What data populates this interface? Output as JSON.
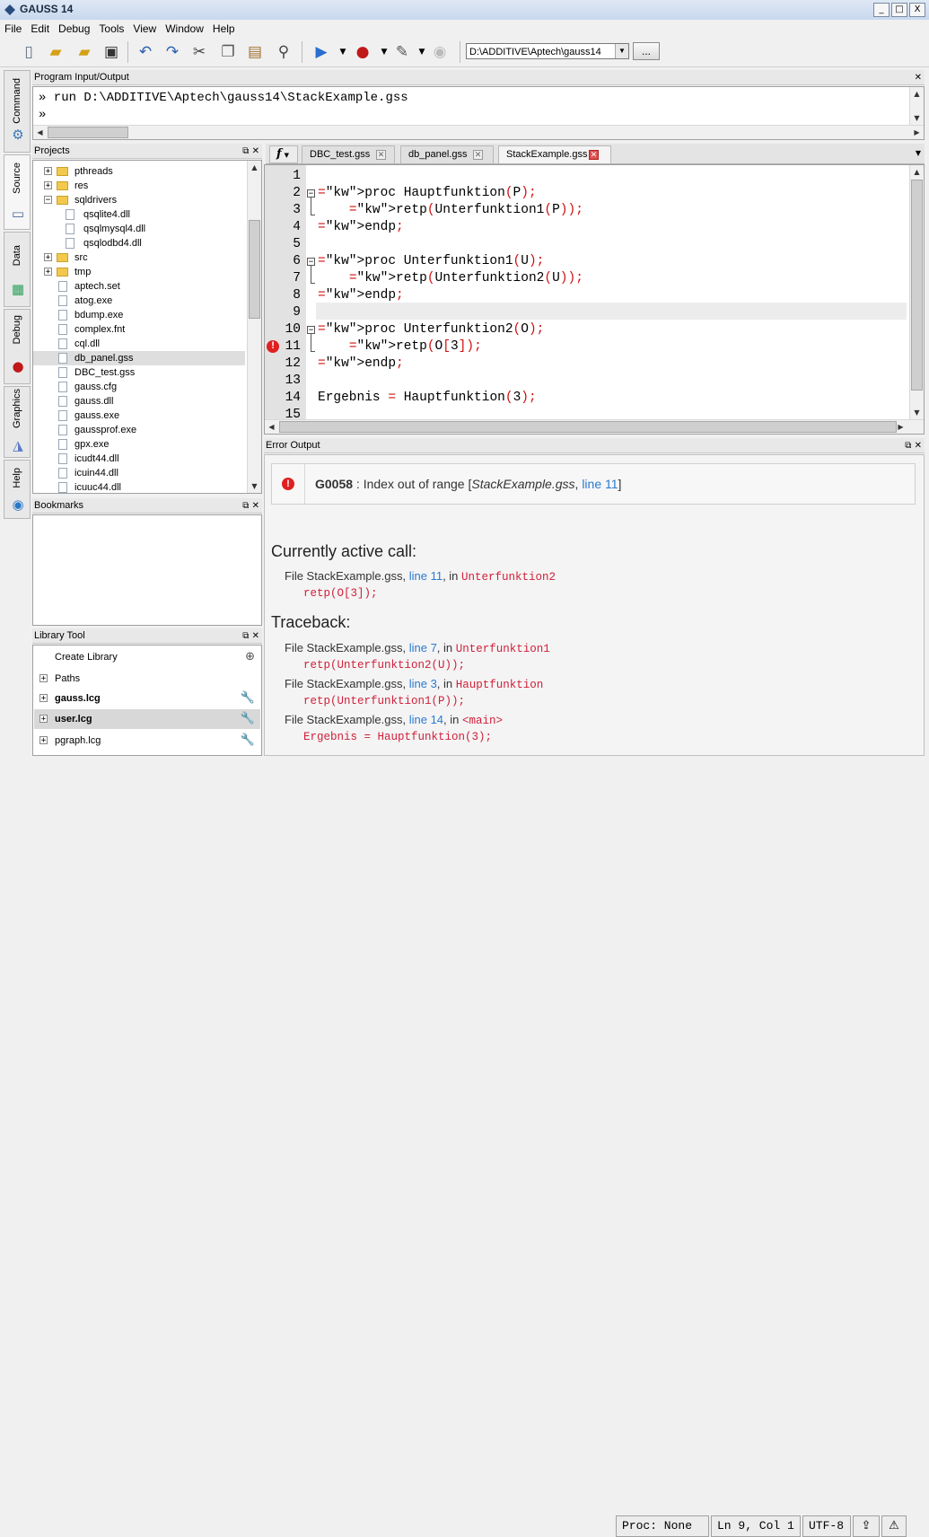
{
  "window": {
    "title": "GAUSS 14",
    "minimize": "_",
    "maximize": "□",
    "close": "X"
  },
  "menu": [
    "File",
    "Edit",
    "Debug",
    "Tools",
    "View",
    "Window",
    "Help"
  ],
  "toolbar": {
    "working_dir": "D:\\ADDITIVE\\Aptech\\gauss14",
    "browse_label": "..."
  },
  "side_tabs": [
    "Command",
    "Source",
    "Data",
    "Debug",
    "Graphics",
    "Help"
  ],
  "program_io": {
    "title": "Program Input/Output",
    "lines": [
      "» run D:\\ADDITIVE\\Aptech\\gauss14\\StackExample.gss",
      "»"
    ]
  },
  "projects": {
    "title": "Projects",
    "items": [
      {
        "name": "pthreads",
        "type": "folder",
        "expander": "+"
      },
      {
        "name": "res",
        "type": "folder",
        "expander": "+"
      },
      {
        "name": "sqldrivers",
        "type": "folder",
        "expander": "−"
      },
      {
        "name": "qsqlite4.dll",
        "type": "file",
        "indent": 1
      },
      {
        "name": "qsqlmysql4.dll",
        "type": "file",
        "indent": 1
      },
      {
        "name": "qsqlodbd4.dll",
        "type": "file",
        "indent": 1
      },
      {
        "name": "src",
        "type": "folder",
        "expander": "+"
      },
      {
        "name": "tmp",
        "type": "folder",
        "expander": "+"
      },
      {
        "name": "aptech.set",
        "type": "file"
      },
      {
        "name": "atog.exe",
        "type": "file"
      },
      {
        "name": "bdump.exe",
        "type": "file"
      },
      {
        "name": "complex.fnt",
        "type": "file"
      },
      {
        "name": "cql.dll",
        "type": "file"
      },
      {
        "name": "db_panel.gss",
        "type": "file",
        "selected": true
      },
      {
        "name": "DBC_test.gss",
        "type": "file"
      },
      {
        "name": "gauss.cfg",
        "type": "file"
      },
      {
        "name": "gauss.dll",
        "type": "file"
      },
      {
        "name": "gauss.exe",
        "type": "file"
      },
      {
        "name": "gaussprof.exe",
        "type": "file"
      },
      {
        "name": "gpx.exe",
        "type": "file"
      },
      {
        "name": "icudt44.dll",
        "type": "file"
      },
      {
        "name": "icuin44.dll",
        "type": "file"
      },
      {
        "name": "icuuc44.dll",
        "type": "file"
      }
    ]
  },
  "bookmarks": {
    "title": "Bookmarks"
  },
  "library_tool": {
    "title": "Library Tool",
    "create_label": "Create Library",
    "items": [
      {
        "name": "Paths",
        "bold": false
      },
      {
        "name": "gauss.lcg",
        "bold": true
      },
      {
        "name": "user.lcg",
        "bold": true,
        "selected": true
      },
      {
        "name": "pgraph.lcg",
        "bold": false
      }
    ]
  },
  "editor": {
    "func_button": "f",
    "tabs": [
      {
        "label": "DBC_test.gss",
        "active": false
      },
      {
        "label": "db_panel.gss",
        "active": false
      },
      {
        "label": "StackExample.gss",
        "active": true
      }
    ],
    "lines": [
      {
        "n": "1",
        "code": ""
      },
      {
        "n": "2",
        "code": "proc Hauptfunktion(P);"
      },
      {
        "n": "3",
        "code": "    retp(Unterfunktion1(P));"
      },
      {
        "n": "4",
        "code": "endp;"
      },
      {
        "n": "5",
        "code": ""
      },
      {
        "n": "6",
        "code": "proc Unterfunktion1(U);"
      },
      {
        "n": "7",
        "code": "    retp(Unterfunktion2(U));"
      },
      {
        "n": "8",
        "code": "endp;"
      },
      {
        "n": "9",
        "code": ""
      },
      {
        "n": "10",
        "code": "proc Unterfunktion2(O);"
      },
      {
        "n": "11",
        "code": "    retp(O[3]);"
      },
      {
        "n": "12",
        "code": "endp;"
      },
      {
        "n": "13",
        "code": ""
      },
      {
        "n": "14",
        "code": "Ergebnis = Hauptfunktion(3);"
      },
      {
        "n": "15",
        "code": ""
      }
    ]
  },
  "error_output": {
    "title": "Error Output",
    "code": "G0058",
    "message": " : Index out of range [",
    "file": "StackExample.gss",
    "sep": ", ",
    "line_link": "line 11",
    "close": "]",
    "active_call_heading": "Currently active call:",
    "active_call": {
      "prefix": "File StackExample.gss, ",
      "link": "line 11",
      "mid": ", in ",
      "func": "Unterfunktion2",
      "code": "retp(O[3]);"
    },
    "traceback_heading": "Traceback:",
    "traceback": [
      {
        "prefix": "File StackExample.gss, ",
        "link": "line 7",
        "mid": ", in ",
        "func": "Unterfunktion1",
        "code": "retp(Unterfunktion2(U));"
      },
      {
        "prefix": "File StackExample.gss, ",
        "link": "line 3",
        "mid": ", in ",
        "func": "Hauptfunktion",
        "code": "retp(Unterfunktion1(P));"
      },
      {
        "prefix": "File StackExample.gss, ",
        "link": "line 14",
        "mid": ", in ",
        "func": "<main>",
        "code": "Ergebnis = Hauptfunktion(3);"
      }
    ]
  },
  "status": {
    "proc": "Proc: None",
    "position": "Ln 9, Col 1",
    "encoding": "UTF-8"
  },
  "colors": {
    "keyword": "#1a1ad6",
    "punct": "#d01010",
    "link": "#2a7ad0",
    "error": "#e02020",
    "pink_code": "#d0203a"
  }
}
